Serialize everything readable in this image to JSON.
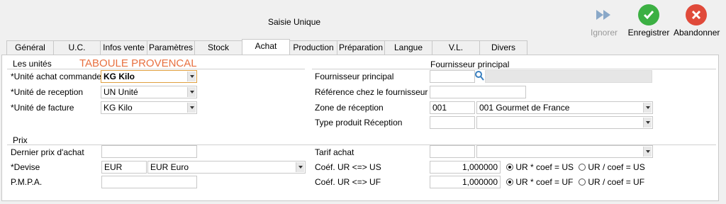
{
  "window": {
    "title": "Saisie Unique"
  },
  "toolbar": {
    "ignore_label": "Ignorer",
    "save_label": "Enregistrer",
    "cancel_label": "Abandonner"
  },
  "colors": {
    "save": "#3cb043",
    "cancel": "#e04a3a",
    "ignore": "#8aa8c8",
    "accent_red": "#e87040"
  },
  "tabs": [
    {
      "label": "Général"
    },
    {
      "label": "U.C."
    },
    {
      "label": "Infos vente"
    },
    {
      "label": "Paramètres"
    },
    {
      "label": "Stock"
    },
    {
      "label": "Achat"
    },
    {
      "label": "Production"
    },
    {
      "label": "Préparation"
    },
    {
      "label": "Langue"
    },
    {
      "label": "V.L."
    },
    {
      "label": "Divers"
    }
  ],
  "active_tab": "Achat",
  "units": {
    "section_label": "Les unités",
    "product_name": "TABOULE PROVENCAL",
    "purchase_order_unit_label": "*Unité achat commande",
    "purchase_order_unit_value": "KG Kilo",
    "reception_unit_label": "*Unité de reception",
    "reception_unit_value": "UN Unité",
    "invoice_unit_label": "*Unité de facture",
    "invoice_unit_value": "KG Kilo"
  },
  "supplier": {
    "section_label": "Fournisseur principal",
    "main_supplier_label": "Fournisseur principal",
    "main_supplier_value": "",
    "supplier_ref_label": "Référence chez le fournisseur",
    "supplier_ref_value": "",
    "reception_zone_label": "Zone de réception",
    "reception_zone_code": "001",
    "reception_zone_value": "001  Gourmet de France",
    "reception_type_label": "Type produit Réception",
    "reception_type_code": "",
    "reception_type_value": ""
  },
  "price": {
    "section_label": "Prix",
    "last_price_label": "Dernier prix d'achat",
    "last_price_value": "",
    "currency_label": "*Devise",
    "currency_code": "EUR",
    "currency_value": "EUR  Euro",
    "pmpa_label": "P.M.P.A.",
    "pmpa_value": "",
    "tariff_label": "Tarif achat",
    "tariff_code": "",
    "tariff_value": "",
    "coef_us_label": "Coéf. UR <=> US",
    "coef_us_value": "1,000000",
    "coef_us_opt1": "UR * coef = US",
    "coef_us_opt2": "UR / coef = US",
    "coef_uf_label": "Coéf. UR <=> UF",
    "coef_uf_value": "1,000000",
    "coef_uf_opt1": "UR * coef = UF",
    "coef_uf_opt2": "UR / coef = UF"
  }
}
